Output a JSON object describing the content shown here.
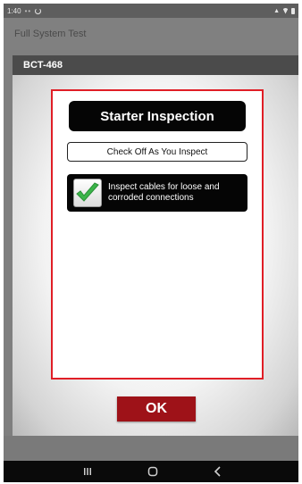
{
  "status_bar": {
    "time": "1:40",
    "icons": [
      "notification-dots-icon",
      "sync-icon",
      "signal-icon",
      "wifi-icon",
      "battery-icon"
    ]
  },
  "app_bar": {
    "title": "Full System Test"
  },
  "device_header": {
    "label": "BCT-468"
  },
  "dialog": {
    "title": "Starter Inspection",
    "subtitle": "Check Off As You Inspect",
    "items": [
      {
        "label": "Inspect cables for loose and corroded connections",
        "checked": true
      }
    ]
  },
  "ok_button": {
    "label": "OK"
  },
  "nav_bar": {
    "buttons": [
      "recents-icon",
      "home-icon",
      "back-icon"
    ]
  },
  "colors": {
    "frame_red": "#e01e26",
    "ok_red": "#9e1218",
    "check_green": "#3bb54a",
    "dark": "#050505",
    "overlay_gray": "#7f7f7f"
  }
}
